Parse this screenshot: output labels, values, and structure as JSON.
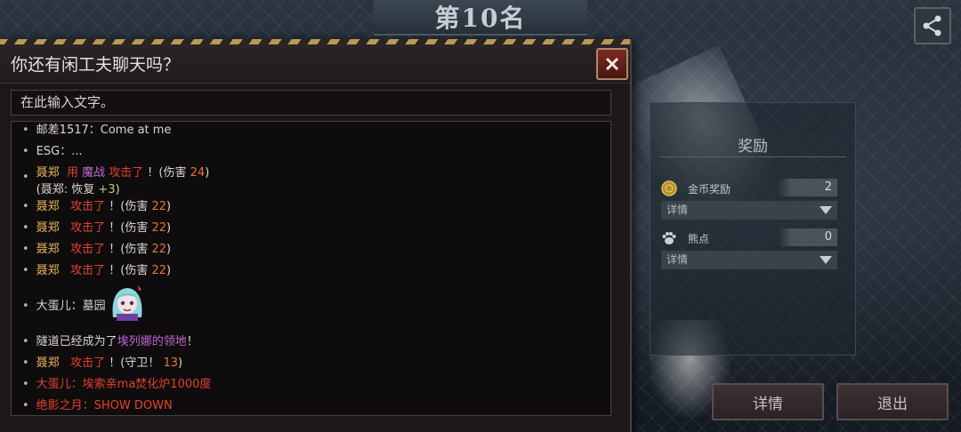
{
  "rank": {
    "title": "第10名"
  },
  "share": {
    "icon": "share-icon"
  },
  "reward": {
    "title": "奖励",
    "gold": {
      "label": "金币奖励",
      "value": "2",
      "select": "详情",
      "icon": "gold-coin-icon"
    },
    "bear": {
      "label": "熊点",
      "value": "0",
      "select": "详情",
      "icon": "bear-paw-icon"
    }
  },
  "buttons": {
    "details": "详情",
    "exit": "退出"
  },
  "chat": {
    "title": "你还有闲工夫聊天吗？",
    "input_placeholder": "在此输入文字。",
    "messages": [
      {
        "text": "邮差1517：Come at me"
      },
      {
        "text": "ESG：..."
      },
      {
        "name": "聂郑",
        "use": "用",
        "skill": "魔战",
        "action": "攻击了",
        "suffix": "！(伤害",
        "dmg": "24",
        "close": ")",
        "sub_name": "(聂郑:",
        "sub_text": "恢复",
        "sub_val": "+3",
        "sub_close": ")"
      },
      {
        "name": "聂郑",
        "action": "攻击了",
        "suffix": "！(伤害",
        "dmg": "22",
        "close": ")"
      },
      {
        "name": "聂郑",
        "action": "攻击了",
        "suffix": "！(伤害",
        "dmg": "22",
        "close": ")"
      },
      {
        "name": "聂郑",
        "action": "攻击了",
        "suffix": "！(伤害",
        "dmg": "22",
        "close": ")"
      },
      {
        "name": "聂郑",
        "action": "攻击了",
        "suffix": "！(伤害",
        "dmg": "22",
        "close": ")"
      },
      {
        "text": "大蛋儿：墓园"
      },
      {
        "pre": "隧道已经成为了",
        "highlight": "埃列娜的领地",
        "post": "！"
      },
      {
        "name": "聂郑",
        "action": "攻击了",
        "suffix": "！(守卫！",
        "dmg": "13",
        "close": ")"
      },
      {
        "text": "大蛋儿：埃索亲ma焚化炉1000度"
      },
      {
        "text": "绝影之月：SHOW DOWN"
      }
    ]
  },
  "colors": {
    "attack_red": "#e2412e",
    "damage_orange": "#e7752f",
    "territory_purple": "#c067d6",
    "heal_green": "#b6d66b"
  }
}
